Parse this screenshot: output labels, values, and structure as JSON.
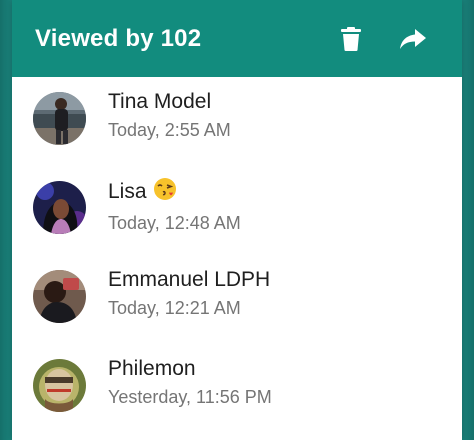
{
  "header": {
    "title": "Viewed by 102",
    "icons": [
      "delete-icon",
      "share-icon"
    ]
  },
  "viewers": [
    {
      "name": "Tina Model",
      "time": "Today, 2:55 AM"
    },
    {
      "name": "Lisa",
      "emoji": "kissing-face-emoji",
      "time": "Today, 12:48 AM"
    },
    {
      "name": "Emmanuel LDPH",
      "time": "Today, 12:21 AM"
    },
    {
      "name": "Philemon",
      "time": "Yesterday, 11:56 PM"
    }
  ],
  "colors": {
    "header": "#128c7e",
    "background": "#1b847d",
    "name_text": "#1f1f1f",
    "time_text": "#757575"
  }
}
